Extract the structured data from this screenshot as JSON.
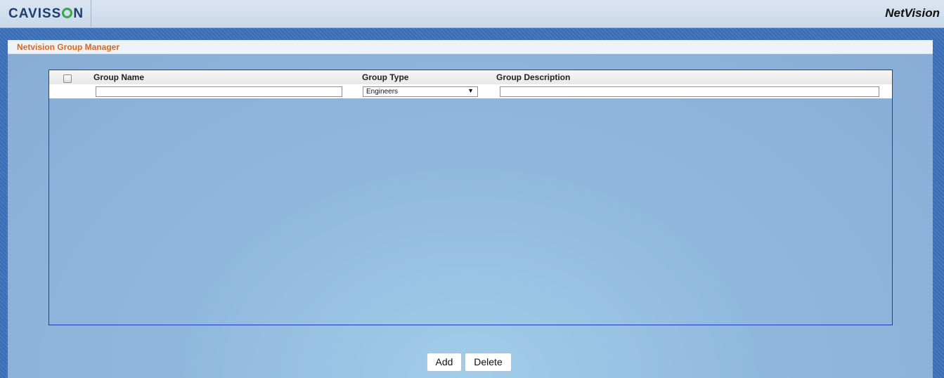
{
  "header": {
    "logo_text_1": "CAVISS",
    "logo_text_2": "N",
    "product_name": "NetVision"
  },
  "panel": {
    "title": "Netvision Group Manager"
  },
  "grid": {
    "columns": {
      "group_name": "Group Name",
      "group_type": "Group Type",
      "group_description": "Group Description"
    },
    "filters": {
      "group_name_value": "",
      "group_type_selected": "Engineers",
      "group_description_value": ""
    },
    "rows": []
  },
  "actions": {
    "add_label": "Add",
    "delete_label": "Delete"
  },
  "colors": {
    "accent_title": "#e0651e",
    "logo_green": "#3aa64a",
    "logo_navy": "#1b3f6f",
    "grid_border": "#1a3fb0"
  }
}
